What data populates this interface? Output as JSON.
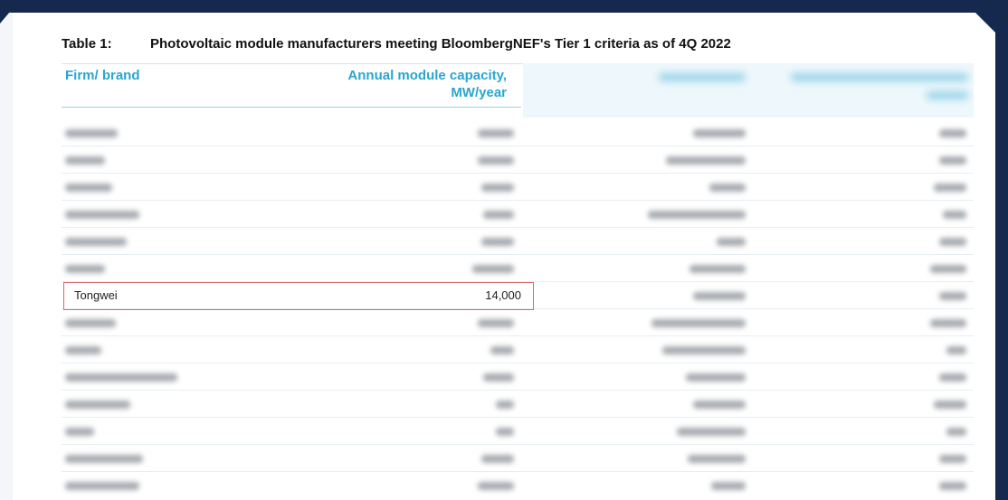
{
  "table": {
    "label": "Table 1:",
    "title": "Photovoltaic module manufacturers meeting BloombergNEF's Tier 1 criteria as of 4Q 2022",
    "headers": {
      "firm": "Firm/ brand",
      "capacity_line1": "Annual module capacity,",
      "capacity_line2": "MW/year"
    },
    "highlighted_row": {
      "firm": "Tongwei",
      "capacity": "14,000"
    }
  },
  "colors": {
    "header_blue": "#29a6d0",
    "highlight_border": "#d96a6a",
    "frame_navy": "#15294f"
  }
}
